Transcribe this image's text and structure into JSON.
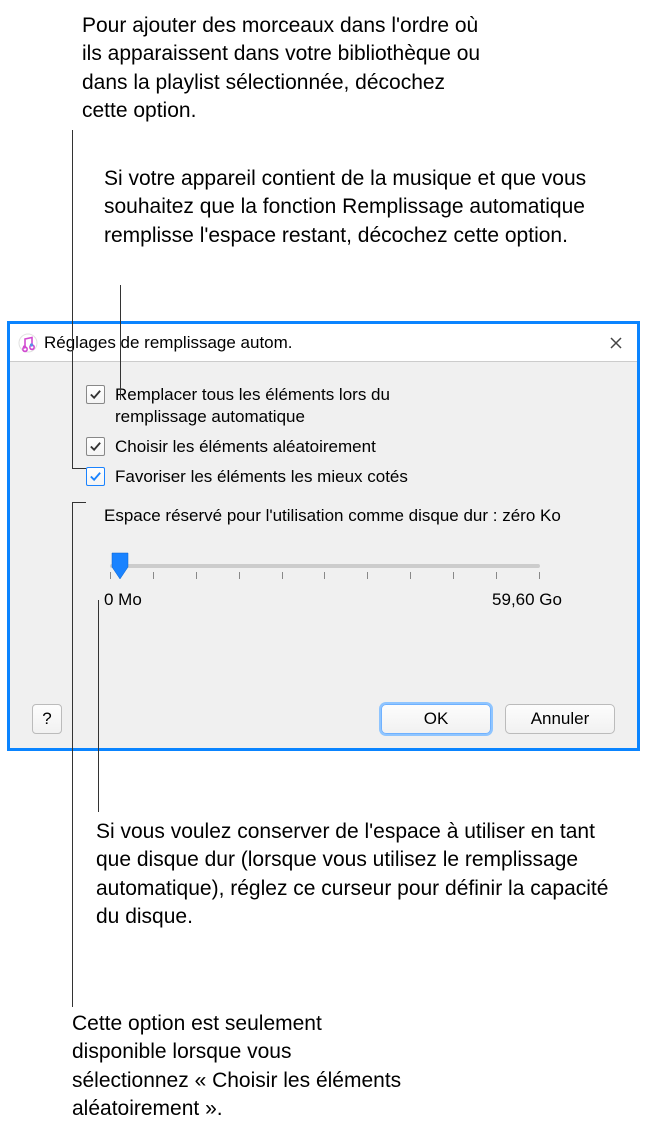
{
  "callouts": {
    "c1": "Pour ajouter des morceaux dans l'ordre où ils apparaissent dans votre bibliothèque ou dans la playlist sélectionnée, décochez cette option.",
    "c2": "Si votre appareil contient de la musique et que vous souhaitez que la fonction Remplissage automatique remplisse l'espace restant, décochez cette option.",
    "c3": "Si vous voulez conserver de l'espace à utiliser en tant que disque dur (lorsque vous utilisez le remplissage automatique), réglez ce curseur pour définir la capacité du disque.",
    "c4": "Cette option est seulement disponible lorsque vous sélectionnez « Choisir les éléments aléatoirement »."
  },
  "dialog": {
    "title": "Réglages de remplissage autom.",
    "checkbox1": "Remplacer tous les éléments lors du remplissage automatique",
    "checkbox2": "Choisir les éléments aléatoirement",
    "checkbox3": "Favoriser les éléments les mieux cotés",
    "reserve_label": "Espace réservé pour l'utilisation comme disque dur : zéro Ko",
    "slider_min": "0 Mo",
    "slider_max": "59,60 Go",
    "ok": "OK",
    "cancel": "Annuler",
    "help": "?"
  }
}
